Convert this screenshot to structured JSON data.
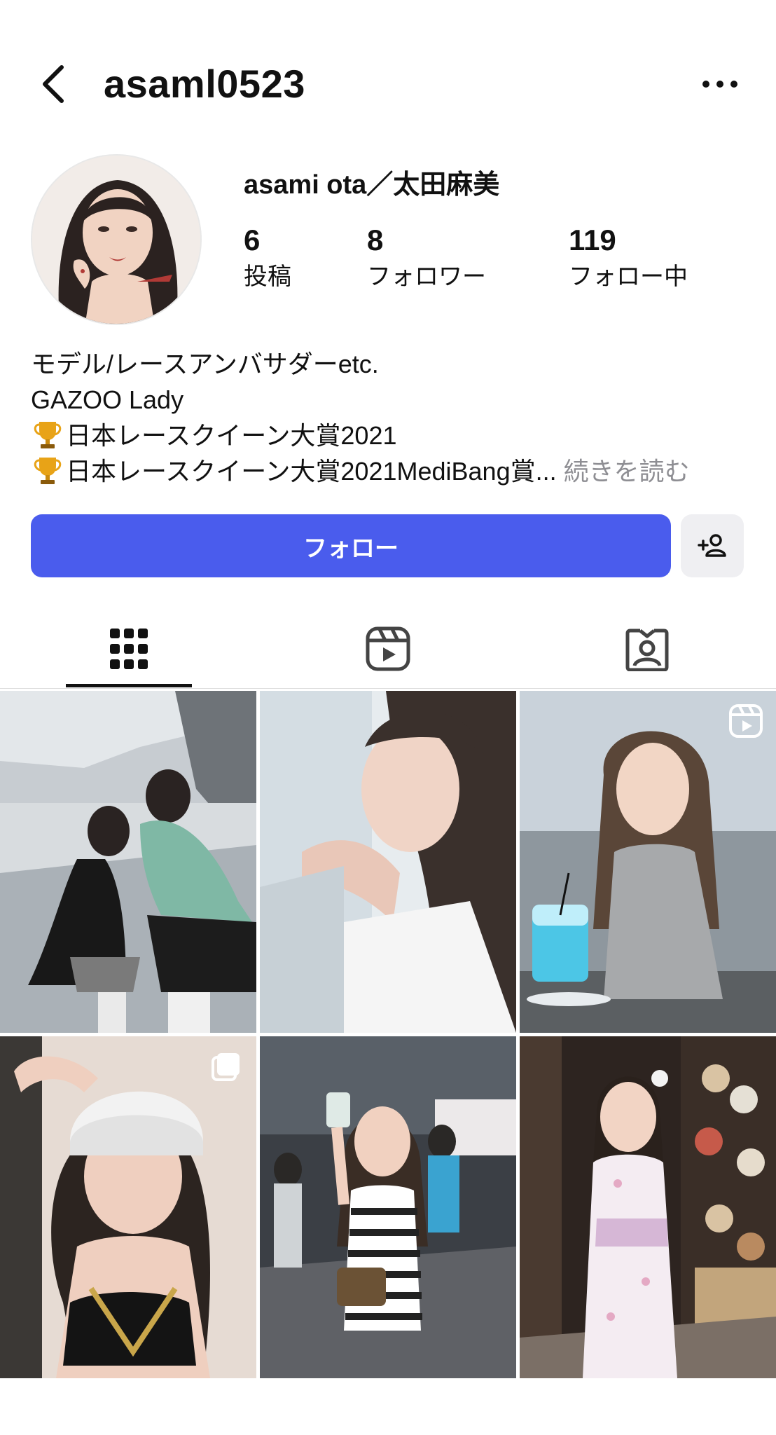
{
  "header": {
    "username": "asaml0523",
    "back_icon": "chevron-left-icon",
    "more_icon": "ellipsis-icon"
  },
  "profile": {
    "display_name": "asami ota／太田麻美",
    "stats": [
      {
        "value": "6",
        "label": "投稿"
      },
      {
        "value": "8",
        "label": "フォロワー"
      },
      {
        "value": "119",
        "label": "フォロー中"
      }
    ],
    "bio": {
      "line1": "モデル/レースアンバサダーetc.",
      "line2": "GAZOO Lady",
      "line3": "日本レースクイーン大賞2021",
      "line4": "日本レースクイーン大賞2021MediBang賞...",
      "more": "続きを読む"
    }
  },
  "actions": {
    "follow_label": "フォロー",
    "suggest_icon": "add-person-icon",
    "accent_color": "#4a5ced"
  },
  "tabs": [
    {
      "name": "posts",
      "icon": "grid-icon",
      "active": true
    },
    {
      "name": "reels",
      "icon": "reels-icon",
      "active": false
    },
    {
      "name": "tagged",
      "icon": "tagged-person-icon",
      "active": false
    }
  ],
  "posts": [
    {
      "badge": null
    },
    {
      "badge": null
    },
    {
      "badge": "reel-icon"
    },
    {
      "badge": "carousel-icon"
    },
    {
      "badge": null
    },
    {
      "badge": null
    }
  ]
}
